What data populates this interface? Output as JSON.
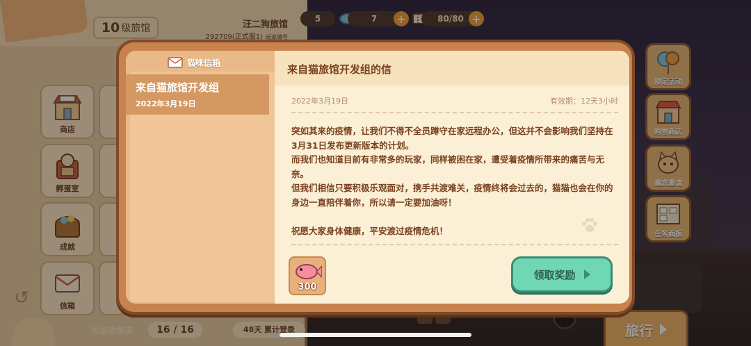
{
  "header": {
    "level_num": "10",
    "level_suffix": "级旅馆",
    "inn_name": "汪二狗旅馆",
    "inn_id": "292709(正式服1)",
    "inn_id_label": "玩家编号"
  },
  "currency": {
    "first_value": "5",
    "fish_value": "7",
    "capacity_value": "80/80"
  },
  "left_grid": {
    "shop": "商店",
    "incubator": "孵蛋室",
    "achievement": "成就",
    "mailbox": "信箱"
  },
  "footer": {
    "collection_label": "功能收集度",
    "collection_value": "16 / 16",
    "days_label": "48天 累计登录"
  },
  "side_buttons": {
    "limited_event": "限定活动",
    "shopping_store": "购物商店",
    "guest_invite": "嘉宾邀请",
    "task_board": "任务面板",
    "travel": "旅行"
  },
  "dialog": {
    "mailbox_title": "猫咪信箱",
    "mail_list": [
      {
        "title": "来自猫旅馆开发组",
        "date": "2022年3月19日"
      }
    ],
    "letter": {
      "title": "来自猫旅馆开发组的信",
      "date": "2022年3月19日",
      "expiry": "有效期：12天3小时",
      "body": "突如其来的疫情，让我们不得不全员蹲守在家远程办公，但这并不会影响我们坚持在3月31日发布更新版本的计划。\n而我们也知道目前有非常多的玩家，同样被困在家，遭受着疫情所带来的痛苦与无奈。\n但我们相信只要积极乐观面对，携手共渡难关，疫情终将会过去的，猫猫也会在你的身边一直陪伴着你，所以请一定要加油呀！\n\n祝愿大家身体健康，平安渡过疫情危机！\n\n"
    },
    "reward": {
      "icon": "fish-icon",
      "qty": "300"
    },
    "claim_label": "领取奖励"
  },
  "colors": {
    "accent_green": "#6fd7b4",
    "panel_brown": "#c7824d",
    "paper": "#fbefd6"
  }
}
